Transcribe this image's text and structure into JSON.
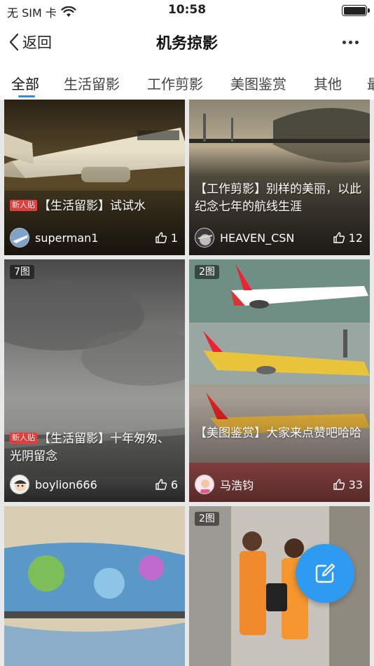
{
  "status_bar": {
    "carrier": "无 SIM 卡",
    "time": "10:58"
  },
  "nav": {
    "back_label": "返回",
    "title": "机务掠影"
  },
  "tabs": [
    {
      "label": "全部",
      "active": true
    },
    {
      "label": "生活留影"
    },
    {
      "label": "工作剪影"
    },
    {
      "label": "美图鉴赏"
    },
    {
      "label": "其他"
    },
    {
      "label": "最"
    }
  ],
  "posts": [
    {
      "title": "【生活留影】试试水",
      "new_badge": "新人贴",
      "author": "superman1",
      "likes": "1"
    },
    {
      "title": "【工作剪影】别样的美丽，以此纪念七年的航线生涯",
      "author": "HEAVEN_CSN",
      "likes": "12"
    },
    {
      "image_count": "7图",
      "title": "【生活留影】十年匆匆、光阴留念",
      "new_badge": "新人贴",
      "author": "boylion666",
      "likes": "6"
    },
    {
      "image_count": "2图",
      "title": "【美图鉴赏】大家来点赞吧哈哈",
      "author": "马浩钧",
      "likes": "33"
    },
    {},
    {
      "image_count": "2图"
    }
  ],
  "colors": {
    "accent": "#2e8ed8",
    "fab": "#2e9bf0",
    "new_badge": "#e8403c"
  },
  "icons": {
    "fab": "compose-icon",
    "likes": "thumbs-up-icon",
    "back": "chevron-left-icon",
    "more": "more-icon"
  }
}
